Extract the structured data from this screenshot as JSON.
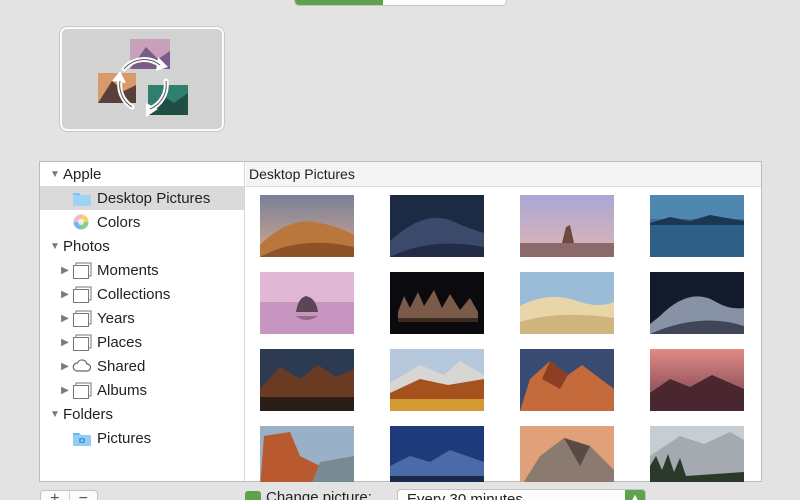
{
  "sidebar": {
    "items": [
      {
        "label": "Apple",
        "kind": "group",
        "disclosure": "open"
      },
      {
        "label": "Desktop Pictures",
        "kind": "folder-blue",
        "selected": true
      },
      {
        "label": "Colors",
        "kind": "colors"
      },
      {
        "label": "Photos",
        "kind": "group",
        "disclosure": "open"
      },
      {
        "label": "Moments",
        "kind": "album",
        "disclosure": "closed"
      },
      {
        "label": "Collections",
        "kind": "album",
        "disclosure": "closed"
      },
      {
        "label": "Years",
        "kind": "album",
        "disclosure": "closed"
      },
      {
        "label": "Places",
        "kind": "album",
        "disclosure": "closed"
      },
      {
        "label": "Shared",
        "kind": "cloud",
        "disclosure": "closed"
      },
      {
        "label": "Albums",
        "kind": "album",
        "disclosure": "closed"
      },
      {
        "label": "Folders",
        "kind": "group",
        "disclosure": "open"
      },
      {
        "label": "Pictures",
        "kind": "folder-pictures"
      }
    ]
  },
  "content": {
    "header": "Desktop Pictures",
    "thumbnails": [
      "mojave-day",
      "mojave-night",
      "high-sierra-rock",
      "lake-dusk",
      "mono-lake-pink",
      "mono-lake-night",
      "desert-dunes",
      "dunes-night",
      "el-capitan-dusk",
      "sierra-autumn",
      "sierra-peaks",
      "sierra-sunset",
      "el-capitan",
      "yosemite-valley",
      "half-dome",
      "yosemite-snow"
    ]
  },
  "bottom": {
    "add_label": "+",
    "remove_label": "−",
    "change_picture_label": "Change picture:",
    "interval_value": "Every 30 minutes"
  },
  "colors": {
    "accent": "#5fa24d",
    "selection": "#dadada",
    "folder_blue": "#7ec3f2"
  }
}
